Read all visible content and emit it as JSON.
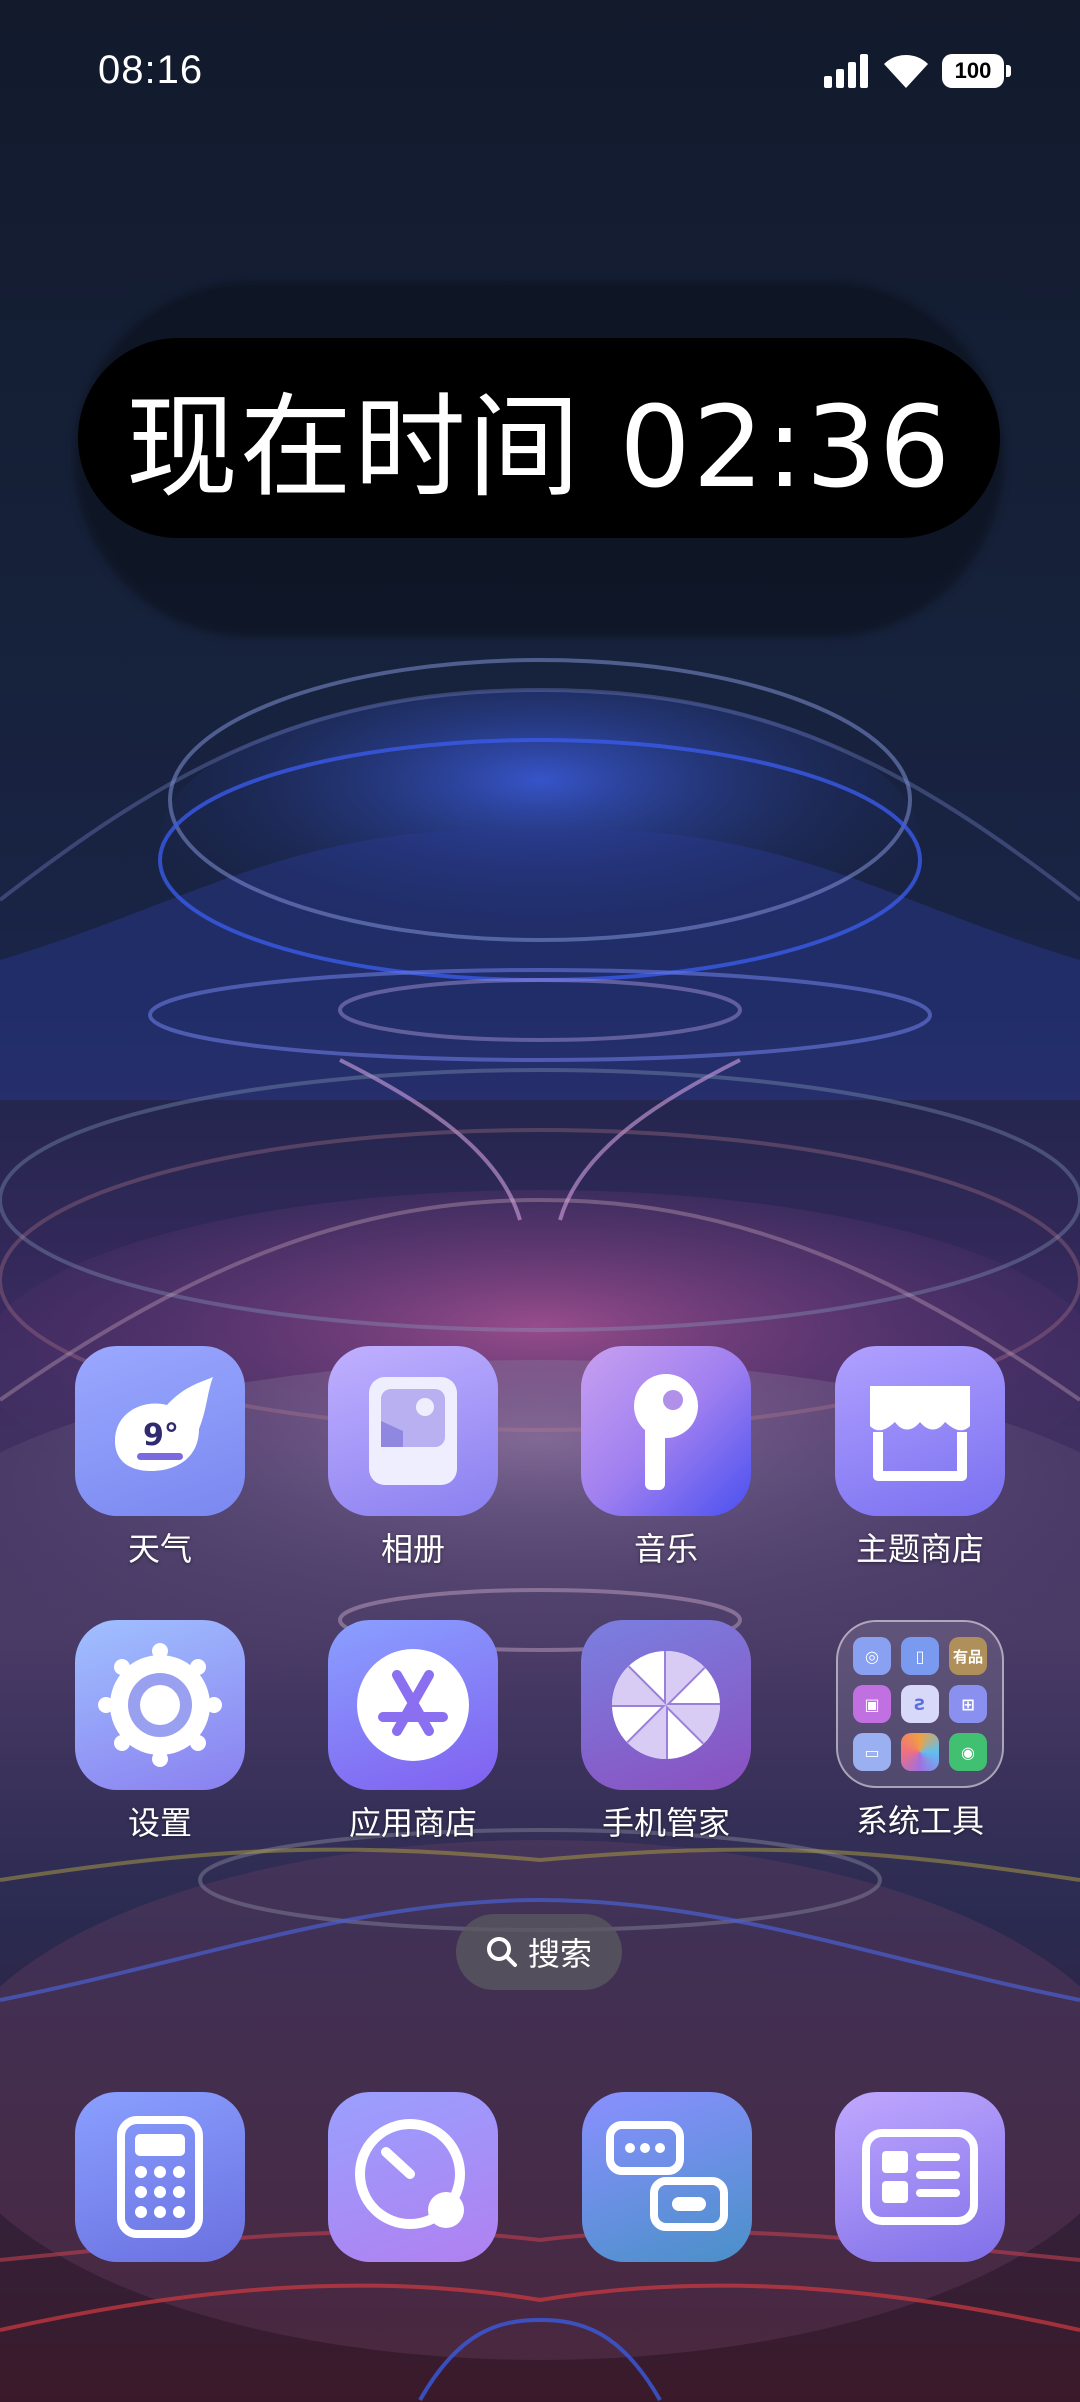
{
  "status_bar": {
    "time": "08:16",
    "battery": "100",
    "signal_icon": "cellular-signal-icon",
    "wifi_icon": "wifi-icon"
  },
  "clock_widget": {
    "text": "现在时间 02:36"
  },
  "apps": [
    {
      "label": "天气",
      "icon": "weather-icon",
      "weather_temp": "9°"
    },
    {
      "label": "相册",
      "icon": "gallery-icon"
    },
    {
      "label": "音乐",
      "icon": "music-icon"
    },
    {
      "label": "主题商店",
      "icon": "theme-store-icon"
    },
    {
      "label": "设置",
      "icon": "settings-icon"
    },
    {
      "label": "应用商店",
      "icon": "app-store-icon"
    },
    {
      "label": "手机管家",
      "icon": "security-icon"
    },
    {
      "label": "系统工具",
      "icon": "folder-icon",
      "folder_badge": "有品"
    }
  ],
  "search": {
    "label": "搜索",
    "icon": "search-icon"
  },
  "dock": [
    {
      "icon": "calculator-icon"
    },
    {
      "icon": "browser-icon"
    },
    {
      "icon": "messages-icon"
    },
    {
      "icon": "notes-icon"
    }
  ]
}
